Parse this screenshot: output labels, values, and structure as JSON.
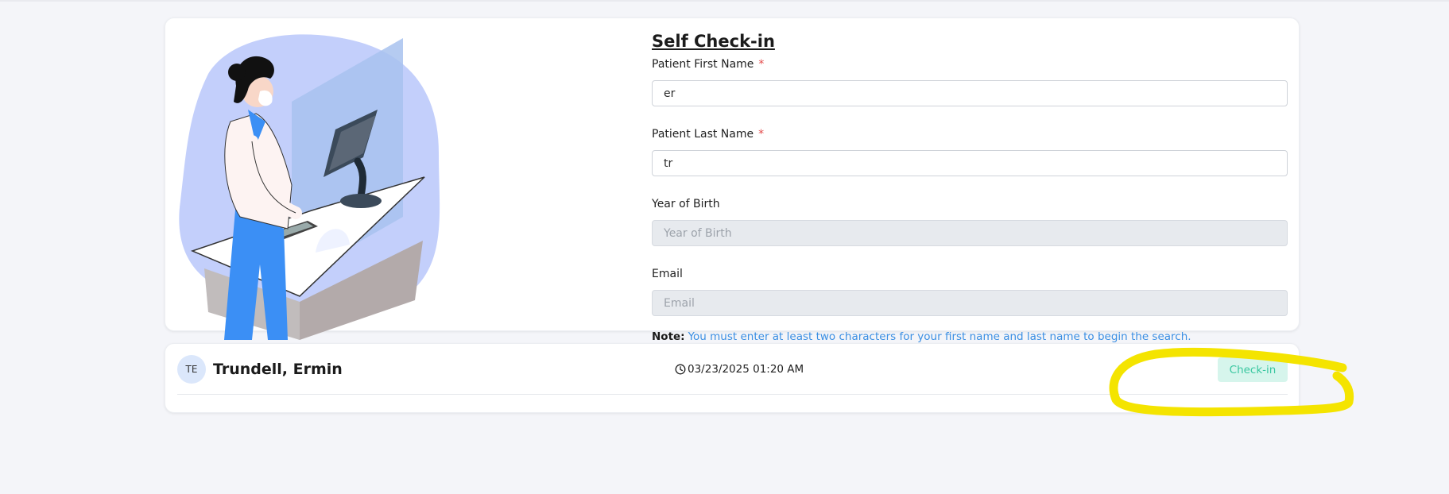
{
  "form": {
    "title": "Self Check-in",
    "first_name": {
      "label": "Patient First Name",
      "required_mark": "*",
      "value": "er"
    },
    "last_name": {
      "label": "Patient Last Name",
      "required_mark": "*",
      "value": "tr"
    },
    "year_of_birth": {
      "label": "Year of Birth",
      "placeholder": "Year of Birth",
      "value": ""
    },
    "email": {
      "label": "Email",
      "placeholder": "Email",
      "value": ""
    },
    "note": {
      "label": "Note:",
      "text": "You must enter at least two characters for your first name and last name to begin the search."
    }
  },
  "results": [
    {
      "initials": "TE",
      "name": "Trundell, Ermin",
      "timestamp": "03/23/2025 01:20 AM",
      "action_label": "Check-in"
    }
  ],
  "icons": {
    "timestamp": "clock-icon",
    "illustration": "self-checkin-kiosk-illustration"
  },
  "colors": {
    "page_background": "#f4f5f9",
    "required_mark": "#e24848",
    "note_text": "#3b8fe3",
    "checkin_button_bg": "#d6f5ec",
    "checkin_button_text": "#39c7a0",
    "avatar_bg": "#dbe7fb",
    "annotation_highlight": "#f4e400"
  }
}
